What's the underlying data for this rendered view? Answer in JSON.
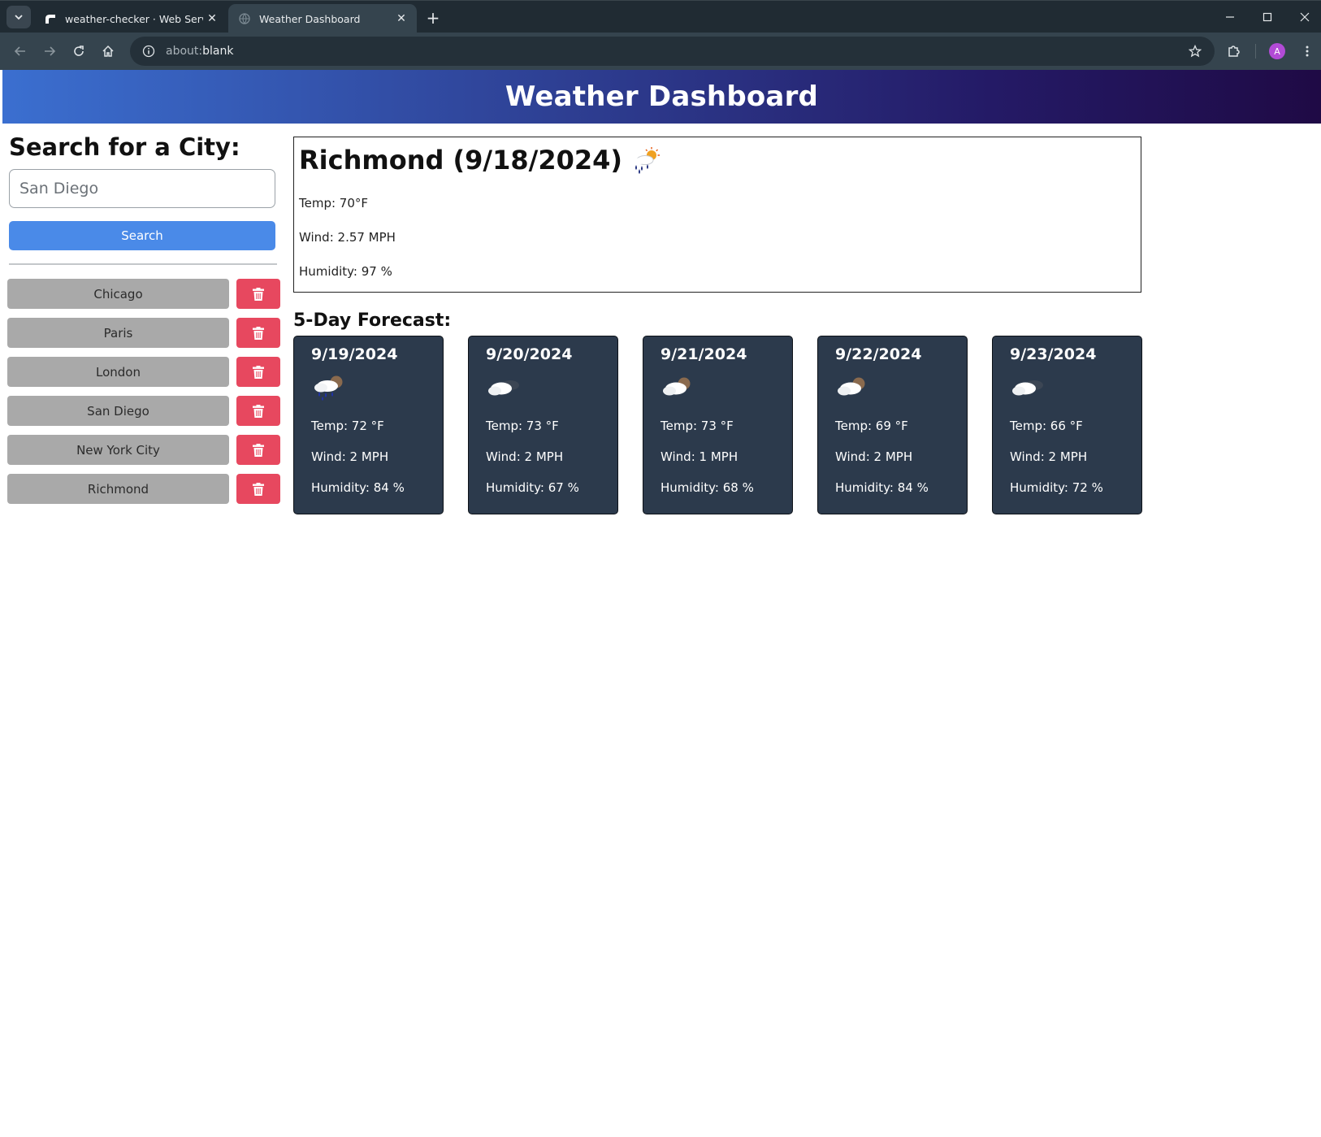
{
  "browser": {
    "tabs": [
      {
        "title": "weather-checker · Web Service",
        "active": false,
        "favicon": "render-logo-icon"
      },
      {
        "title": "Weather Dashboard",
        "active": true,
        "favicon": "globe-icon"
      }
    ],
    "url_prefix": "about:",
    "url_host": "blank",
    "profile_initial": "A"
  },
  "header": {
    "title": "Weather Dashboard"
  },
  "sidebar": {
    "heading": "Search for a City:",
    "search_placeholder": "San Diego",
    "search_button": "Search",
    "history": [
      {
        "city": "Chicago"
      },
      {
        "city": "Paris"
      },
      {
        "city": "London"
      },
      {
        "city": "San Diego"
      },
      {
        "city": "New York City"
      },
      {
        "city": "Richmond"
      }
    ]
  },
  "today": {
    "title": "Richmond (9/18/2024)",
    "icon": "rain-sun-icon",
    "temp": "Temp: 70°F",
    "wind": "Wind: 2.57 MPH",
    "humidity": "Humidity: 97 %"
  },
  "forecast": {
    "title": "5-Day Forecast:",
    "days": [
      {
        "date": "9/19/2024",
        "icon": "rain-cloud-icon",
        "temp": "Temp: 72 °F",
        "wind": "Wind: 2 MPH",
        "humidity": "Humidity: 84 %"
      },
      {
        "date": "9/20/2024",
        "icon": "overcast-clouds-icon",
        "temp": "Temp: 73 °F",
        "wind": "Wind: 2 MPH",
        "humidity": "Humidity: 67 %"
      },
      {
        "date": "9/21/2024",
        "icon": "broken-clouds-icon",
        "temp": "Temp: 73 °F",
        "wind": "Wind: 1 MPH",
        "humidity": "Humidity: 68 %"
      },
      {
        "date": "9/22/2024",
        "icon": "broken-clouds-icon",
        "temp": "Temp: 69 °F",
        "wind": "Wind: 2 MPH",
        "humidity": "Humidity: 84 %"
      },
      {
        "date": "9/23/2024",
        "icon": "overcast-clouds-icon",
        "temp": "Temp: 66 °F",
        "wind": "Wind: 2 MPH",
        "humidity": "Humidity: 72 %"
      }
    ]
  },
  "colors": {
    "header_gradient_start": "#3b6fd0",
    "header_gradient_end": "#1f0a45",
    "search_button": "#4a8ae8",
    "history_button": "#a9a9a9",
    "delete_button": "#e7485f",
    "forecast_card": "#2c3a4c"
  }
}
